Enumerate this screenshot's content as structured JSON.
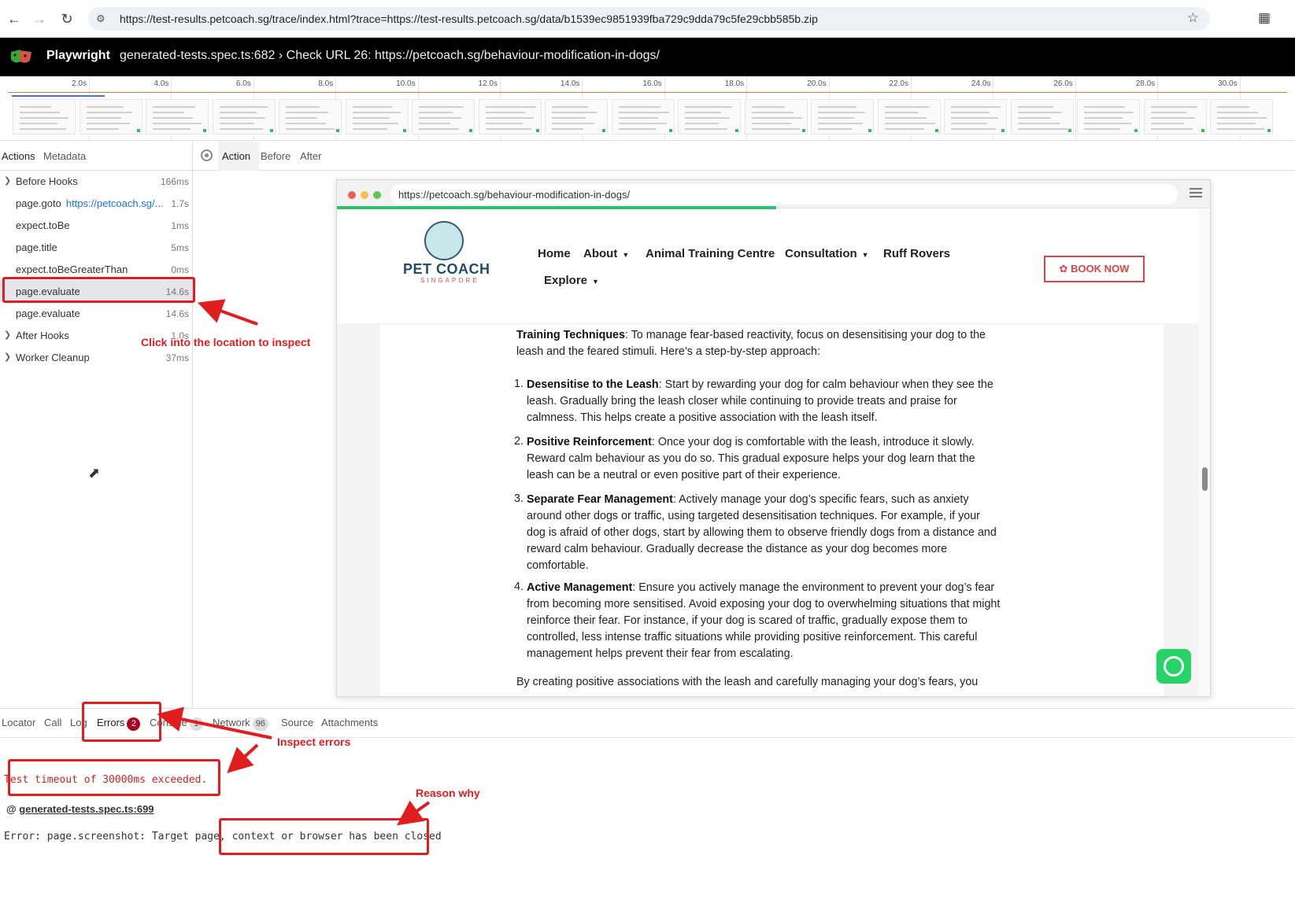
{
  "browser": {
    "url": "https://test-results.petcoach.sg/trace/index.html?trace=https://test-results.petcoach.sg/data/b1539ec9851939fba729c9dda79c5fe29cbb585b.zip"
  },
  "header": {
    "brand": "Playwright",
    "title": "generated-tests.spec.ts:682 › Check URL 26: https://petcoach.sg/behaviour-modification-in-dogs/"
  },
  "timeline": {
    "ticks": [
      "2.0s",
      "4.0s",
      "6.0s",
      "8.0s",
      "10.0s",
      "12.0s",
      "14.0s",
      "16.0s",
      "18.0s",
      "20.0s",
      "22.0s",
      "24.0s",
      "26.0s",
      "28.0s",
      "30.0s"
    ]
  },
  "sidebar": {
    "tabs": [
      "Actions",
      "Metadata"
    ],
    "actions": [
      {
        "label": "Before Hooks",
        "duration": "166ms",
        "expandable": true
      },
      {
        "label": "page.goto",
        "link": "https://petcoach.sg/...",
        "duration": "1.7s"
      },
      {
        "label": "expect.toBe",
        "duration": "1ms"
      },
      {
        "label": "page.title",
        "duration": "5ms"
      },
      {
        "label": "expect.toBeGreaterThan",
        "duration": "0ms"
      },
      {
        "label": "page.evaluate",
        "duration": "14.6s",
        "selected": true
      },
      {
        "label": "page.evaluate",
        "duration": "14.6s"
      },
      {
        "label": "After Hooks",
        "duration": "1.0s",
        "expandable": true
      },
      {
        "label": "Worker Cleanup",
        "duration": "37ms",
        "expandable": true
      }
    ]
  },
  "snapshot_tabs": [
    "Action",
    "Before",
    "After"
  ],
  "snapshot": {
    "url": "https://petcoach.sg/behaviour-modification-in-dogs/",
    "logo": {
      "title": "PET COACH",
      "subtitle": "SINGAPORE"
    },
    "nav": [
      "Home",
      "About",
      "Animal Training Centre",
      "Consultation",
      "Ruff Rovers",
      "Explore"
    ],
    "book_now": "BOOK NOW",
    "intro_bold": "Training Techniques",
    "intro_text": ": To manage fear-based reactivity, focus on desensitising your dog to the leash and the feared stimuli. Here’s a step-by-step approach:",
    "steps": [
      {
        "n": "1.",
        "bold": "Desensitise to the Leash",
        "text": ": Start by rewarding your dog for calm behaviour when they see the leash. Gradually bring the leash closer while continuing to provide treats and praise for calmness. This helps create a positive association with the leash itself."
      },
      {
        "n": "2.",
        "bold": "Positive Reinforcement",
        "text": ": Once your dog is comfortable with the leash, introduce it slowly. Reward calm behaviour as you do so. This gradual exposure helps your dog learn that the leash can be a neutral or even positive part of their experience."
      },
      {
        "n": "3.",
        "bold": "Separate Fear Management",
        "text": ": Actively manage your dog’s specific fears, such as anxiety around other dogs or traffic, using targeted desensitisation techniques. For example, if your dog is afraid of other dogs, start by allowing them to observe friendly dogs from a distance and reward calm behaviour. Gradually decrease the distance as your dog becomes more comfortable."
      },
      {
        "n": "4.",
        "bold": "Active Management",
        "text": ": Ensure you actively manage the environment to prevent your dog’s fear from becoming more sensitised. Avoid exposing your dog to overwhelming situations that might reinforce their fear. For instance, if your dog is scared of traffic, gradually expose them to controlled, less intense traffic situations while providing positive reinforcement. This careful management helps prevent their fear from escalating."
      }
    ],
    "closing": "By creating positive associations with the leash and carefully managing your dog’s fears, you"
  },
  "bottom": {
    "tabs": {
      "locator": "Locator",
      "call": "Call",
      "log": "Log",
      "errors": "Errors",
      "errors_count": "2",
      "console": "Console",
      "console_count": "1",
      "network": "Network",
      "network_count": "96",
      "source": "Source",
      "attachments": "Attachments"
    },
    "error1": "Test timeout of 30000ms exceeded.",
    "error_location_prefix": "@ ",
    "error_location": "generated-tests.spec.ts:699",
    "error2": "Error: page.screenshot: Target page, context or browser has been closed"
  },
  "annotations": {
    "click_hint": "Click into the location to inspect",
    "inspect_errors": "Inspect errors",
    "reason_why": "Reason why"
  },
  "colors": {
    "header_bg": "#000000",
    "annotation": "#e01e1e",
    "error_text": "#d21f1f",
    "link": "#1a73e8",
    "progress": "#2fbf71"
  }
}
